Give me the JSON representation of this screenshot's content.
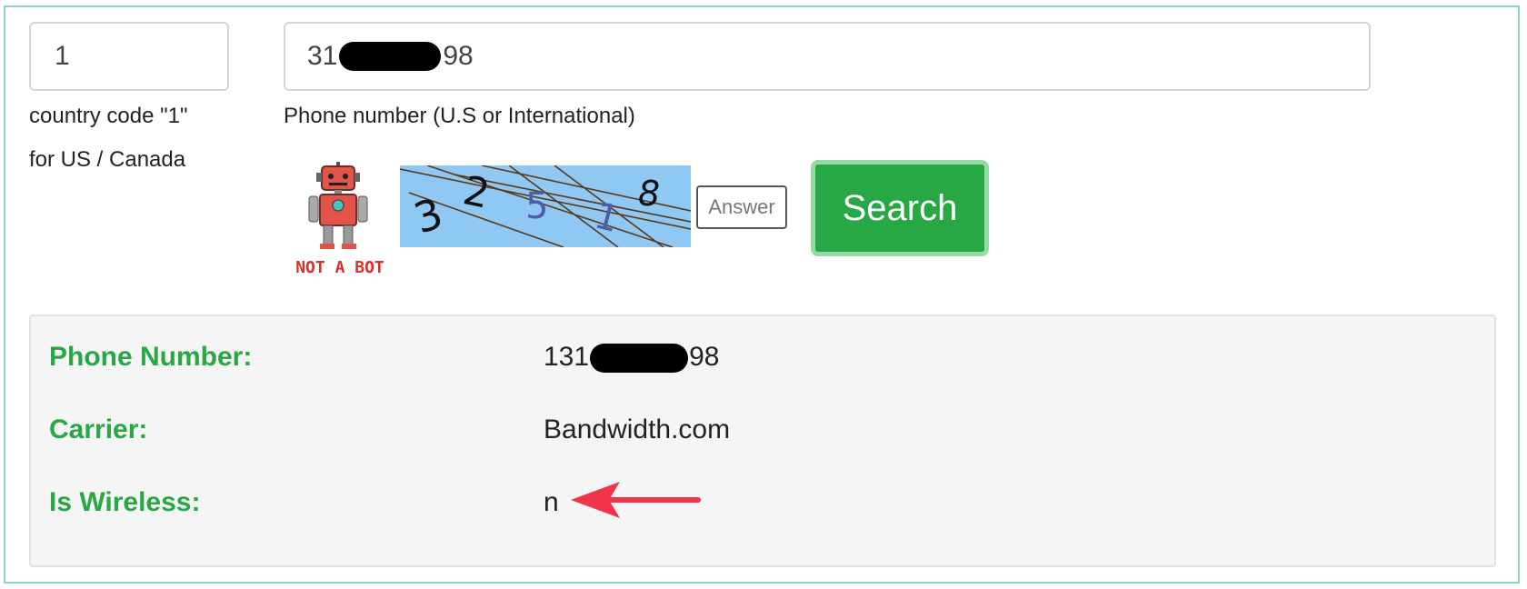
{
  "form": {
    "country_code": {
      "value": "1",
      "help_line1": "country code \"1\"",
      "help_line2": "for US / Canada"
    },
    "phone": {
      "value_prefix": "31",
      "value_suffix": "98",
      "help": "Phone number (U.S or International)"
    },
    "captcha": {
      "robot_caption": "NOT A BOT",
      "characters": [
        "3",
        "2",
        "5",
        "1",
        "8"
      ],
      "answer_placeholder": "Answer"
    },
    "search_button": "Search"
  },
  "results": {
    "phone_number": {
      "label": "Phone Number:",
      "value_prefix": "131",
      "value_suffix": "98"
    },
    "carrier": {
      "label": "Carrier:",
      "value": "Bandwidth.com"
    },
    "is_wireless": {
      "label": "Is Wireless:",
      "value": "n"
    }
  },
  "colors": {
    "accent_green": "#28a745",
    "button_green": "#27a844",
    "frame_border": "#8fd4b0",
    "arrow_red": "#f0344a"
  }
}
